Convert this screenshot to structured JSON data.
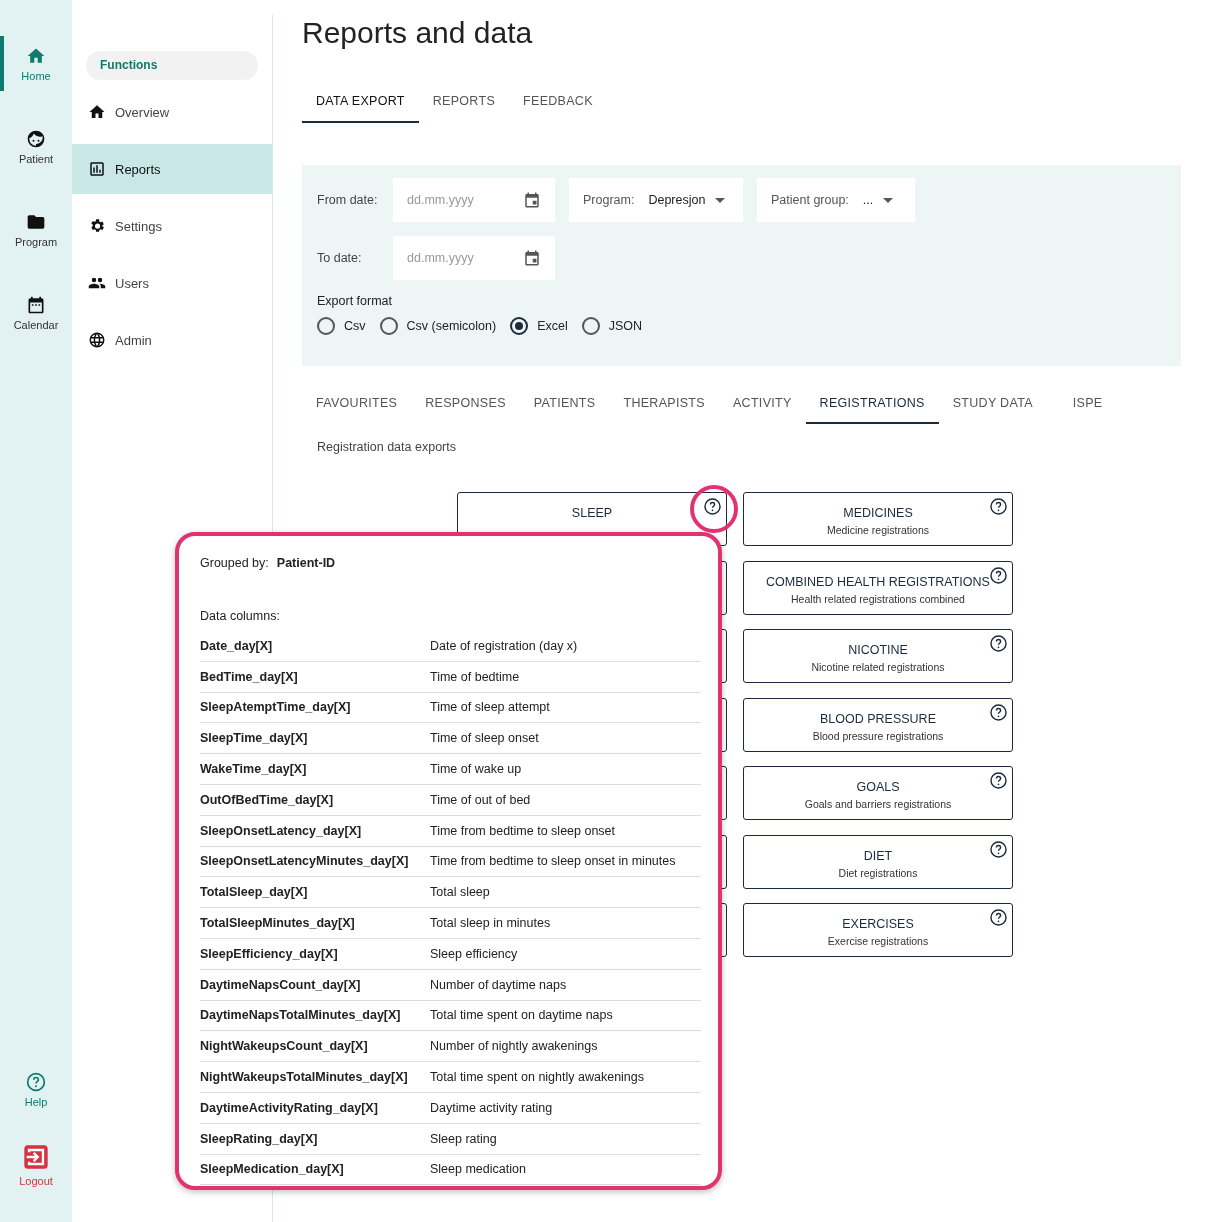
{
  "rail": {
    "items": [
      {
        "label": "Home",
        "kind": "home",
        "selected": true
      },
      {
        "label": "Patient",
        "kind": "face",
        "selected": false
      },
      {
        "label": "Program",
        "kind": "folder",
        "selected": false
      },
      {
        "label": "Calendar",
        "kind": "calendar",
        "selected": false
      }
    ],
    "bottom": [
      {
        "label": "Help",
        "kind": "help"
      },
      {
        "label": "Logout",
        "kind": "logout"
      }
    ]
  },
  "functions_menu": {
    "header": "Functions",
    "items": [
      {
        "label": "Overview",
        "kind": "home",
        "selected": false
      },
      {
        "label": "Reports",
        "kind": "chart",
        "selected": true
      },
      {
        "label": "Settings",
        "kind": "gear",
        "selected": false
      },
      {
        "label": "Users",
        "kind": "users",
        "selected": false
      },
      {
        "label": "Admin",
        "kind": "globe",
        "selected": false
      }
    ]
  },
  "page_title": "Reports and data",
  "tabs": [
    {
      "label": "DATA EXPORT",
      "selected": true
    },
    {
      "label": "REPORTS",
      "selected": false
    },
    {
      "label": "FEEDBACK",
      "selected": false
    }
  ],
  "filters": {
    "from_date": {
      "label": "From date:",
      "placeholder": "dd.mm.yyyy"
    },
    "to_date": {
      "label": "To date:",
      "placeholder": "dd.mm.yyyy"
    },
    "program": {
      "label": "Program:",
      "value": "Depresjon"
    },
    "patient_group": {
      "label": "Patient group:",
      "value": "..."
    },
    "export_format": {
      "label": "Export format",
      "options": [
        {
          "label": "Csv",
          "selected": false
        },
        {
          "label": "Csv (semicolon)",
          "selected": false
        },
        {
          "label": "Excel",
          "selected": true
        },
        {
          "label": "JSON",
          "selected": false
        }
      ]
    }
  },
  "report_tabs": [
    {
      "label": "FAVOURITES",
      "selected": false
    },
    {
      "label": "RESPONSES",
      "selected": false
    },
    {
      "label": "PATIENTS",
      "selected": false
    },
    {
      "label": "THERAPISTS",
      "selected": false
    },
    {
      "label": "ACTIVITY",
      "selected": false
    },
    {
      "label": "REGISTRATIONS",
      "selected": true
    },
    {
      "label": "STUDY DATA",
      "selected": false
    },
    {
      "label": "ISPE",
      "selected": false
    }
  ],
  "section_label": "Registration data exports",
  "sleep_card": {
    "title": "SLEEP"
  },
  "cards": [
    {
      "title": "MEDICINES",
      "subtitle": "Medicine registrations"
    },
    {
      "title": "COMBINED HEALTH REGISTRATIONS",
      "subtitle": "Health related registrations combined"
    },
    {
      "title": "NICOTINE",
      "subtitle": "Nicotine related registrations"
    },
    {
      "title": "BLOOD PRESSURE",
      "subtitle": "Blood pressure registrations"
    },
    {
      "title": "GOALS",
      "subtitle": "Goals and barriers registrations"
    },
    {
      "title": "DIET",
      "subtitle": "Diet registrations"
    },
    {
      "title": "EXERCISES",
      "subtitle": "Exercise registrations"
    }
  ],
  "popover": {
    "grouped_by_label": "Grouped by:",
    "grouped_by_value": "Patient-ID",
    "data_columns_label": "Data columns:",
    "rows": [
      {
        "name": "Date_day[X]",
        "description": "Date of registration (day x)"
      },
      {
        "name": "BedTime_day[X]",
        "description": "Time of bedtime"
      },
      {
        "name": "SleepAtemptTime_day[X]",
        "description": "Time of sleep attempt"
      },
      {
        "name": "SleepTime_day[X]",
        "description": "Time of sleep onset"
      },
      {
        "name": "WakeTime_day[X]",
        "description": "Time of wake up"
      },
      {
        "name": "OutOfBedTime_day[X]",
        "description": "Time of out of bed"
      },
      {
        "name": "SleepOnsetLatency_day[X]",
        "description": "Time from bedtime to sleep onset"
      },
      {
        "name": "SleepOnsetLatencyMinutes_day[X]",
        "description": "Time from bedtime to sleep onset in minutes"
      },
      {
        "name": "TotalSleep_day[X]",
        "description": "Total sleep"
      },
      {
        "name": "TotalSleepMinutes_day[X]",
        "description": "Total sleep in minutes"
      },
      {
        "name": "SleepEfficiency_day[X]",
        "description": "Sleep efficiency"
      },
      {
        "name": "DaytimeNapsCount_day[X]",
        "description": "Number of daytime naps"
      },
      {
        "name": "DaytimeNapsTotalMinutes_day[X]",
        "description": "Total time spent on daytime naps"
      },
      {
        "name": "NightWakeupsCount_day[X]",
        "description": "Number of nightly awakenings"
      },
      {
        "name": "NightWakeupsTotalMinutes_day[X]",
        "description": "Total time spent on nightly awakenings"
      },
      {
        "name": "DaytimeActivityRating_day[X]",
        "description": "Daytime activity rating"
      },
      {
        "name": "SleepRating_day[X]",
        "description": "Sleep rating"
      },
      {
        "name": "SleepMedication_day[X]",
        "description": "Sleep medication"
      }
    ]
  }
}
